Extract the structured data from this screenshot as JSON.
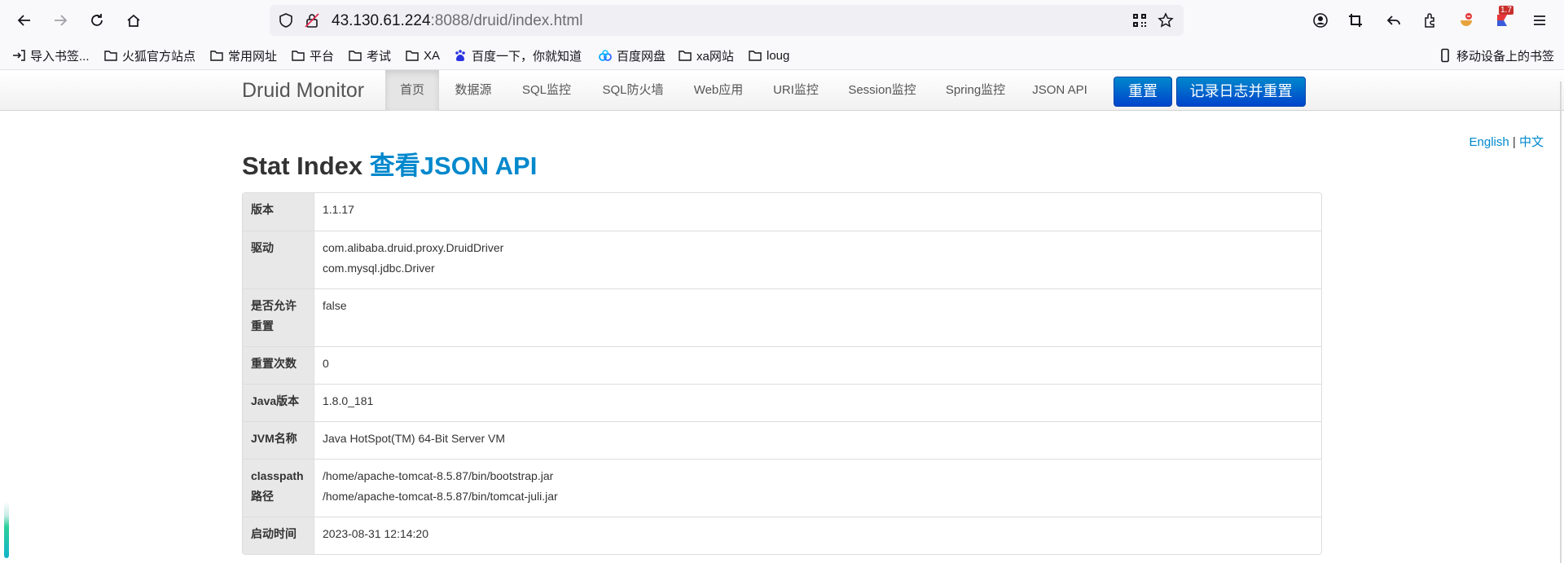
{
  "browser": {
    "url_host": "43.130.61.224",
    "url_rest": ":8088/druid/index.html",
    "badge_count": "1.7",
    "bookmarks": [
      {
        "label": "导入书签...",
        "icon": "import-icon"
      },
      {
        "label": "火狐官方站点",
        "icon": "folder-icon"
      },
      {
        "label": "常用网址",
        "icon": "folder-icon"
      },
      {
        "label": "平台",
        "icon": "folder-icon"
      },
      {
        "label": "考试",
        "icon": "folder-icon"
      },
      {
        "label": "XA",
        "icon": "folder-icon"
      },
      {
        "label": "百度一下，你就知道",
        "icon": "baidu-icon"
      },
      {
        "label": "百度网盘",
        "icon": "baidu-netdisk-icon"
      },
      {
        "label": "xa网站",
        "icon": "folder-icon"
      },
      {
        "label": "loug",
        "icon": "folder-icon"
      }
    ],
    "mobile_bookmarks": "移动设备上的书签"
  },
  "nav": {
    "brand": "Druid Monitor",
    "items": [
      "首页",
      "数据源",
      "SQL监控",
      "SQL防火墙",
      "Web应用",
      "URI监控",
      "Session监控",
      "Spring监控",
      "JSON API"
    ],
    "reset_button": "重置",
    "log_reset_button": "记录日志并重置"
  },
  "lang": {
    "english": "English",
    "separator": "|",
    "chinese": "中文"
  },
  "page": {
    "title": "Stat Index",
    "title_link": "查看JSON API"
  },
  "stats": [
    {
      "key": "版本",
      "values": [
        "1.1.17"
      ]
    },
    {
      "key": "驱动",
      "values": [
        "com.alibaba.druid.proxy.DruidDriver",
        "com.mysql.jdbc.Driver"
      ]
    },
    {
      "key": "是否允许重置",
      "values": [
        "false"
      ]
    },
    {
      "key": "重置次数",
      "values": [
        "0"
      ]
    },
    {
      "key": "Java版本",
      "values": [
        "1.8.0_181"
      ]
    },
    {
      "key": "JVM名称",
      "values": [
        "Java HotSpot(TM) 64-Bit Server VM"
      ]
    },
    {
      "key": "classpath路径",
      "values": [
        "/home/apache-tomcat-8.5.87/bin/bootstrap.jar",
        "/home/apache-tomcat-8.5.87/bin/tomcat-juli.jar"
      ]
    },
    {
      "key": "启动时间",
      "values": [
        "2023-08-31 12:14:20"
      ]
    }
  ],
  "colors": {
    "link": "#0088cc",
    "button": "#0055cc",
    "key_bg": "#e8e8e8"
  }
}
